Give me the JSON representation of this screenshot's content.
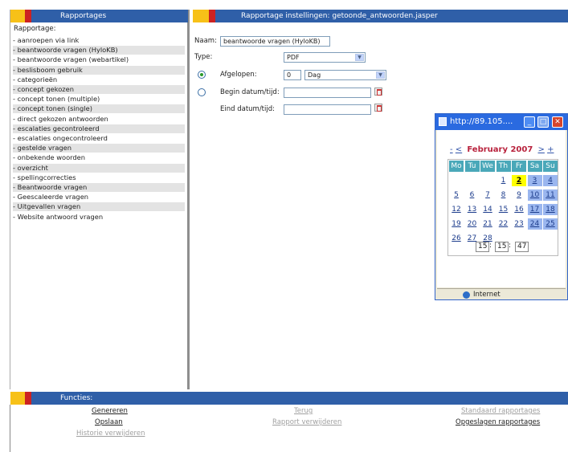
{
  "left_panel": {
    "header": "Rapportages",
    "section_label": "Rapportage:",
    "items": [
      {
        "label": "- aanroepen via link",
        "shaded": false
      },
      {
        "label": "- beantwoorde vragen (HyloKB)",
        "shaded": true
      },
      {
        "label": "- beantwoorde vragen (webartikel)",
        "shaded": false
      },
      {
        "label": "- beslisboom gebruik",
        "shaded": true
      },
      {
        "label": "- categorieën",
        "shaded": false
      },
      {
        "label": "- concept gekozen",
        "shaded": true
      },
      {
        "label": "- concept tonen (multiple)",
        "shaded": false
      },
      {
        "label": "- concept tonen (single)",
        "shaded": true
      },
      {
        "label": "- direct gekozen antwoorden",
        "shaded": false
      },
      {
        "label": "- escalaties gecontroleerd",
        "shaded": true
      },
      {
        "label": "- escalaties ongecontroleerd",
        "shaded": false
      },
      {
        "label": "- gestelde vragen",
        "shaded": true
      },
      {
        "label": "- onbekende woorden",
        "shaded": false
      },
      {
        "label": "- overzicht",
        "shaded": true
      },
      {
        "label": "- spellingcorrecties",
        "shaded": false
      },
      {
        "label": "- Beantwoorde vragen",
        "shaded": true
      },
      {
        "label": "- Geescaleerde vragen",
        "shaded": false
      },
      {
        "label": "- Uitgevallen vragen",
        "shaded": true
      },
      {
        "label": "- Website antwoord vragen",
        "shaded": false
      }
    ]
  },
  "settings": {
    "header": "Rapportage instellingen: getoonde_antwoorden.jasper",
    "name_label": "Naam:",
    "name_value": "beantwoorde vragen (HyloKB)",
    "type_label": "Type:",
    "type_value": "PDF",
    "elapsed_label": "Afgelopen:",
    "elapsed_value": "0",
    "elapsed_unit": "Dag",
    "begin_label": "Begin datum/tijd:",
    "end_label": "Eind datum/tijd:"
  },
  "popup": {
    "title": "http://89.105....",
    "month_label": "February 2007",
    "nav_prev_year": "-",
    "nav_prev_month": "<",
    "nav_next_month": ">",
    "nav_next_year": "+",
    "weekdays": [
      "Mo",
      "Tu",
      "We",
      "Th",
      "Fr",
      "Sa",
      "Su"
    ],
    "weeks": [
      [
        "",
        "",
        "",
        "1",
        "2",
        "3",
        "4"
      ],
      [
        "5",
        "6",
        "7",
        "8",
        "9",
        "10",
        "11"
      ],
      [
        "12",
        "13",
        "14",
        "15",
        "16",
        "17",
        "18"
      ],
      [
        "19",
        "20",
        "21",
        "22",
        "23",
        "24",
        "25"
      ],
      [
        "26",
        "27",
        "28",
        "",
        "",
        "",
        ""
      ]
    ],
    "today": "2",
    "time_h": "15",
    "time_m": "15",
    "time_s": "47",
    "time_sep": ":",
    "status": "Internet"
  },
  "functions": {
    "header": "Functies:",
    "generate": "Genereren",
    "back": "Terug",
    "standard_reports": "Standaard rapportages",
    "save": "Opslaan",
    "delete_report": "Rapport verwijderen",
    "saved_reports": "Opgeslagen rapportages",
    "delete_history": "Historie verwijderen"
  }
}
